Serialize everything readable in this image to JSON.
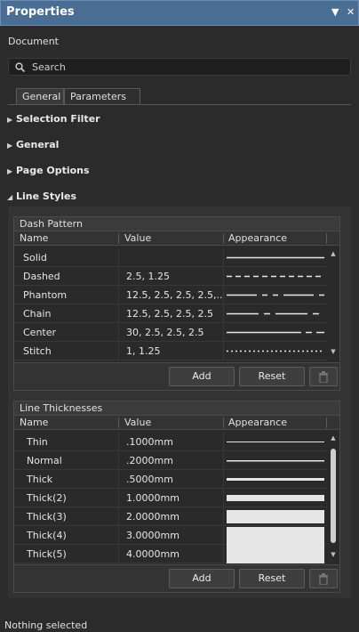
{
  "panel": {
    "title": "Properties",
    "pin_icon": "dropdown-arrow-icon",
    "close_icon": "close-icon"
  },
  "document_label": "Document",
  "search": {
    "placeholder": "Search"
  },
  "tabs": [
    {
      "label": "General",
      "active": true
    },
    {
      "label": "Parameters",
      "active": false
    }
  ],
  "sections": [
    {
      "label": "Selection Filter",
      "expanded": false
    },
    {
      "label": "General",
      "expanded": false
    },
    {
      "label": "Page Options",
      "expanded": false
    },
    {
      "label": "Line Styles",
      "expanded": true
    }
  ],
  "dash_pattern": {
    "title": "Dash Pattern",
    "columns": [
      "Name",
      "Value",
      "Appearance"
    ],
    "rows": [
      {
        "name": "Solid",
        "value": ""
      },
      {
        "name": "Dashed",
        "value": "2.5, 1.25"
      },
      {
        "name": "Phantom",
        "value": "12.5, 2.5, 2.5, 2.5,..."
      },
      {
        "name": "Chain",
        "value": "12.5, 2.5, 2.5, 2.5"
      },
      {
        "name": "Center",
        "value": "30, 2.5, 2.5, 2.5"
      },
      {
        "name": "Stitch",
        "value": "1, 1.25"
      }
    ],
    "add_label": "Add",
    "reset_label": "Reset"
  },
  "line_thicknesses": {
    "title": "Line Thicknesses",
    "columns": [
      "Name",
      "Value",
      "Appearance"
    ],
    "rows": [
      {
        "name": "Thin",
        "value": ".1000mm"
      },
      {
        "name": "Normal",
        "value": ".2000mm"
      },
      {
        "name": "Thick",
        "value": ".5000mm"
      },
      {
        "name": "Thick(2)",
        "value": "1.0000mm"
      },
      {
        "name": "Thick(3)",
        "value": "2.0000mm"
      },
      {
        "name": "Thick(4)",
        "value": "3.0000mm"
      },
      {
        "name": "Thick(5)",
        "value": "4.0000mm"
      }
    ],
    "add_label": "Add",
    "reset_label": "Reset"
  },
  "status": "Nothing selected",
  "colors": {
    "title_bar": "#4a6d93",
    "background": "#2b2b2b",
    "line": "#e6e6e6"
  }
}
